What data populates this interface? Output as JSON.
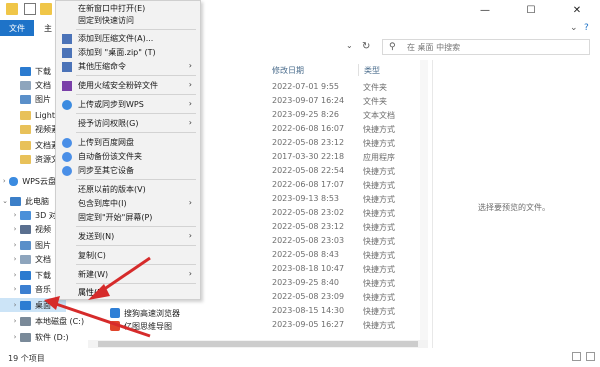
{
  "ribbon": {
    "file_tab": "文件",
    "home_tab_partial": "主"
  },
  "search": {
    "placeholder": "在 桌面 中搜索"
  },
  "sidebar": {
    "items": [
      {
        "label": "下载",
        "icon": "download-icon",
        "color": "#2b7bd0"
      },
      {
        "label": "文档",
        "icon": "document-icon",
        "color": "#8ea5bd"
      },
      {
        "label": "图片",
        "icon": "picture-icon",
        "color": "#5a8fc9"
      },
      {
        "label": "Lightr",
        "icon": "folder-icon",
        "color": "#e8c15a"
      },
      {
        "label": "视频素",
        "icon": "folder-icon",
        "color": "#e8c15a"
      },
      {
        "label": "文档素",
        "icon": "folder-icon",
        "color": "#e8c15a"
      },
      {
        "label": "资源文",
        "icon": "folder-icon",
        "color": "#e8c15a"
      },
      {
        "label": "WPS云盘",
        "icon": "cloud-icon",
        "color": "#3b8be0"
      },
      {
        "label": "此电脑",
        "icon": "computer-icon",
        "color": "#3c7fc8"
      },
      {
        "label": "3D 对象",
        "icon": "cube-icon",
        "color": "#4a90d9"
      },
      {
        "label": "视频",
        "icon": "video-icon",
        "color": "#5a6f8f"
      },
      {
        "label": "图片",
        "icon": "picture-icon",
        "color": "#5a8fc9"
      },
      {
        "label": "文档",
        "icon": "document-icon",
        "color": "#8ea5bd"
      },
      {
        "label": "下载",
        "icon": "download-icon",
        "color": "#2b7bd0"
      },
      {
        "label": "音乐",
        "icon": "music-icon",
        "color": "#3b7fd1"
      },
      {
        "label": "桌面",
        "icon": "desktop-icon",
        "color": "#2d7dd2"
      },
      {
        "label": "本地磁盘 (C:)",
        "icon": "drive-icon",
        "color": "#7a8a99"
      },
      {
        "label": "软件 (D:)",
        "icon": "drive-icon",
        "color": "#7a8a99"
      }
    ]
  },
  "columns": {
    "modified": "修改日期",
    "type": "类型"
  },
  "files": [
    {
      "date": "2022-07-01 9:55",
      "type": "文件夹"
    },
    {
      "date": "2023-09-07 16:24",
      "type": "文件夹"
    },
    {
      "date": "2023-09-25 8:26",
      "type": "文本文档"
    },
    {
      "date": "2022-06-08 16:07",
      "type": "快捷方式"
    },
    {
      "date": "2022-05-08 23:12",
      "type": "快捷方式"
    },
    {
      "date": "2017-03-30 22:18",
      "type": "应用程序"
    },
    {
      "date": "2022-05-08 22:54",
      "type": "快捷方式"
    },
    {
      "date": "2022-06-08 17:07",
      "type": "快捷方式"
    },
    {
      "date": "2023-09-13 8:53",
      "type": "快捷方式"
    },
    {
      "date": "2022-05-08 23:02",
      "type": "快捷方式"
    },
    {
      "date": "2022-05-08 23:12",
      "type": "快捷方式"
    },
    {
      "date": "2022-05-08 23:03",
      "type": "快捷方式"
    },
    {
      "date": "2022-05-08 8:43",
      "type": "快捷方式"
    },
    {
      "date": "2023-08-18 10:47",
      "type": "快捷方式"
    },
    {
      "date": "2023-09-25 8:40",
      "type": "快捷方式"
    },
    {
      "date": "2022-05-08 23:09",
      "type": "快捷方式"
    },
    {
      "date": "2023-08-15 14:30",
      "type": "快捷方式"
    },
    {
      "date": "2023-09-05 16:27",
      "type": "快捷方式"
    }
  ],
  "partial_names": [
    {
      "label": "搜狗高速浏览器",
      "color": "#2f7fd6"
    },
    {
      "label": "亿图思维导图",
      "color": "#e0442b"
    }
  ],
  "preview": {
    "message": "选择要预览的文件。"
  },
  "status": {
    "count": "19 个项目"
  },
  "context_menu": {
    "items": [
      {
        "label": "在新窗口中打开(E)",
        "icon": "",
        "arrow": false
      },
      {
        "label": "固定到快速访问",
        "icon": "",
        "arrow": false
      },
      {
        "label": "添加到压缩文件(A)...",
        "icon": "archive-icon",
        "arrow": false
      },
      {
        "label": "添加到 \"桌面.zip\" (T)",
        "icon": "archive-icon",
        "arrow": false
      },
      {
        "label": "其他压缩命令",
        "icon": "archive-icon",
        "arrow": true
      },
      {
        "label": "使用火绒安全粉碎文件",
        "icon": "shield-icon",
        "arrow": true
      },
      {
        "label": "上传或同步到WPS",
        "icon": "cloud-icon",
        "arrow": true
      },
      {
        "label": "授予访问权限(G)",
        "icon": "",
        "arrow": true
      },
      {
        "label": "上传到百度网盘",
        "icon": "baidu-cloud-icon",
        "arrow": false
      },
      {
        "label": "自动备份该文件夹",
        "icon": "baidu-cloud-icon",
        "arrow": false
      },
      {
        "label": "同步至其它设备",
        "icon": "baidu-cloud-icon",
        "arrow": false
      },
      {
        "label": "还原以前的版本(V)",
        "icon": "",
        "arrow": false
      },
      {
        "label": "包含到库中(I)",
        "icon": "",
        "arrow": true
      },
      {
        "label": "固定到\"开始\"屏幕(P)",
        "icon": "",
        "arrow": false
      },
      {
        "label": "发送到(N)",
        "icon": "",
        "arrow": true
      },
      {
        "label": "复制(C)",
        "icon": "",
        "arrow": false
      },
      {
        "label": "新建(W)",
        "icon": "",
        "arrow": true
      },
      {
        "label": "属性(R)",
        "icon": "",
        "arrow": false
      }
    ]
  },
  "colors": {
    "accent": "#1e73c8",
    "annotation": "#d62b2b",
    "selected": "#cce4f7"
  }
}
